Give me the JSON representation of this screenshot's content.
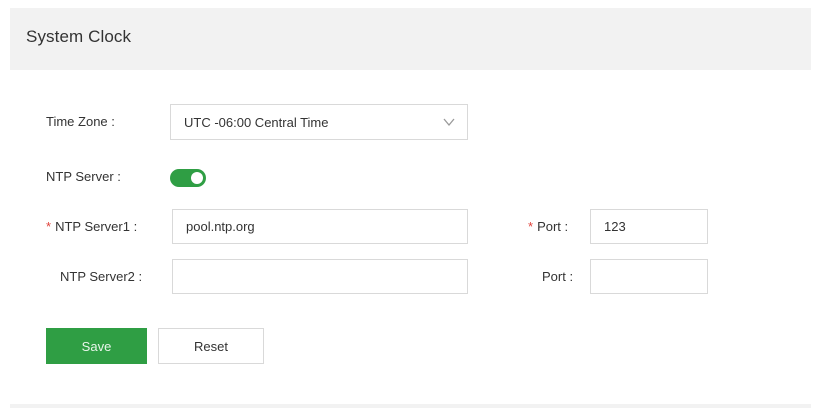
{
  "header": {
    "title": "System Clock"
  },
  "form": {
    "time_zone": {
      "label": "Time Zone :",
      "value": "UTC -06:00 Central Time"
    },
    "ntp_server": {
      "label": "NTP Server :",
      "enabled": true
    },
    "ntp_server1": {
      "required_mark": "*",
      "label": "NTP Server1 :",
      "value": "pool.ntp.org",
      "port_label": "Port :",
      "port_value": "123"
    },
    "ntp_server2": {
      "label": "NTP Server2 :",
      "value": "",
      "port_label": "Port :",
      "port_value": ""
    }
  },
  "buttons": {
    "save_label": "Save",
    "reset_label": "Reset"
  },
  "icons": {
    "time_zone_dropdown": "chevron-down-icon"
  },
  "colors": {
    "accent": "#2f9e44",
    "required": "#e0413a",
    "border": "#d9d9d9",
    "header_bg": "#f2f2f2"
  }
}
